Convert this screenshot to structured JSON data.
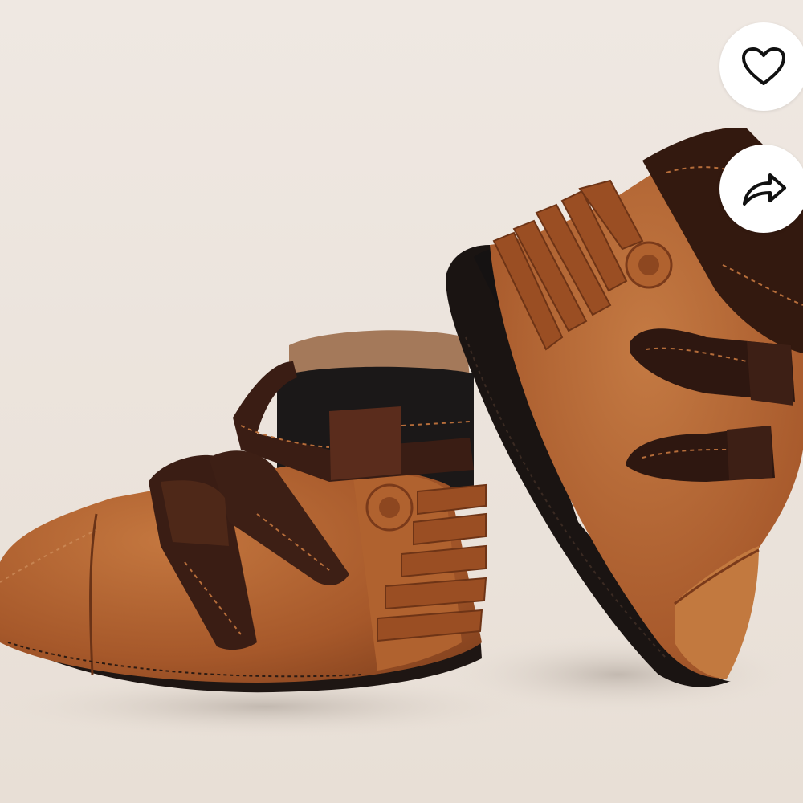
{
  "product_image": {
    "subject": "baby-leather-booties",
    "colors": {
      "background": "#ede5dd",
      "leather_tan": "#a8582a",
      "leather_dark": "#3a1d14",
      "sole": "#1e1613"
    }
  },
  "actions": {
    "favorite": {
      "icon": "heart-icon",
      "color": "#111111"
    },
    "share": {
      "icon": "share-arrow-icon",
      "color": "#111111"
    }
  }
}
